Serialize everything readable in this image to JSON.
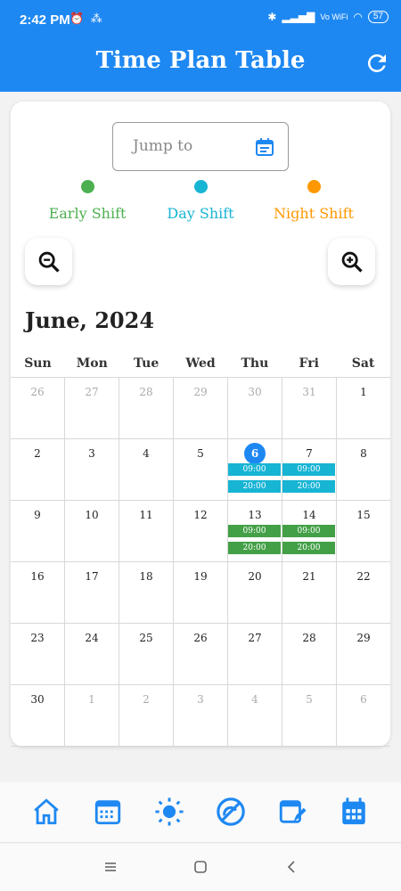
{
  "status_bar": {
    "time": "2:42 PM",
    "battery": "57",
    "network": "Vo WiFi"
  },
  "app_bar": {
    "title": "Time Plan Table",
    "refresh_icon": "refresh-icon"
  },
  "jump_to": {
    "placeholder": "Jump to",
    "icon": "calendar-icon"
  },
  "legend": [
    {
      "label": "Early Shift",
      "color": "#4caf50"
    },
    {
      "label": "Day Shift",
      "color": "#17b4d4"
    },
    {
      "label": "Night Shift",
      "color": "#ff9800"
    }
  ],
  "zoom": {
    "out_icon": "zoom-out-icon",
    "in_icon": "zoom-in-icon"
  },
  "calendar": {
    "month_label": "June, 2024",
    "weekdays": [
      "Sun",
      "Mon",
      "Tue",
      "Wed",
      "Thu",
      "Fri",
      "Sat"
    ],
    "weeks": [
      [
        {
          "d": "26",
          "other": true
        },
        {
          "d": "27",
          "other": true
        },
        {
          "d": "28",
          "other": true
        },
        {
          "d": "29",
          "other": true
        },
        {
          "d": "30",
          "other": true
        },
        {
          "d": "31",
          "other": true
        },
        {
          "d": "1"
        }
      ],
      [
        {
          "d": "2"
        },
        {
          "d": "3"
        },
        {
          "d": "4"
        },
        {
          "d": "5"
        },
        {
          "d": "6",
          "today": true,
          "shifts": [
            {
              "type": "day",
              "time": "09:00"
            },
            {
              "type": "day",
              "time": "20:00"
            }
          ]
        },
        {
          "d": "7",
          "shifts": [
            {
              "type": "day",
              "time": "09:00"
            },
            {
              "type": "day",
              "time": "20:00"
            }
          ]
        },
        {
          "d": "8"
        }
      ],
      [
        {
          "d": "9"
        },
        {
          "d": "10"
        },
        {
          "d": "11"
        },
        {
          "d": "12"
        },
        {
          "d": "13",
          "shifts": [
            {
              "type": "early",
              "time": "09:00"
            },
            {
              "type": "early",
              "time": "20:00"
            }
          ]
        },
        {
          "d": "14",
          "shifts": [
            {
              "type": "early",
              "time": "09:00"
            },
            {
              "type": "early",
              "time": "20:00"
            }
          ]
        },
        {
          "d": "15"
        }
      ],
      [
        {
          "d": "16"
        },
        {
          "d": "17"
        },
        {
          "d": "18"
        },
        {
          "d": "19"
        },
        {
          "d": "20"
        },
        {
          "d": "21"
        },
        {
          "d": "22"
        }
      ],
      [
        {
          "d": "23"
        },
        {
          "d": "24"
        },
        {
          "d": "25"
        },
        {
          "d": "26"
        },
        {
          "d": "27"
        },
        {
          "d": "28"
        },
        {
          "d": "29"
        }
      ],
      [
        {
          "d": "30"
        },
        {
          "d": "1",
          "other": true
        },
        {
          "d": "2",
          "other": true
        },
        {
          "d": "3",
          "other": true
        },
        {
          "d": "4",
          "other": true
        },
        {
          "d": "5",
          "other": true
        },
        {
          "d": "6",
          "other": true
        }
      ]
    ]
  },
  "bottom_nav": [
    "home-icon",
    "calendar-grid-icon",
    "sun-icon",
    "no-sun-icon",
    "calendar-edit-icon",
    "calendar-month-icon"
  ],
  "system_nav": [
    "recents-icon",
    "home-button-icon",
    "back-icon"
  ],
  "colors": {
    "primary": "#1e88f2",
    "early": "#4caf50",
    "day": "#17b4d4",
    "night": "#ff9800"
  }
}
